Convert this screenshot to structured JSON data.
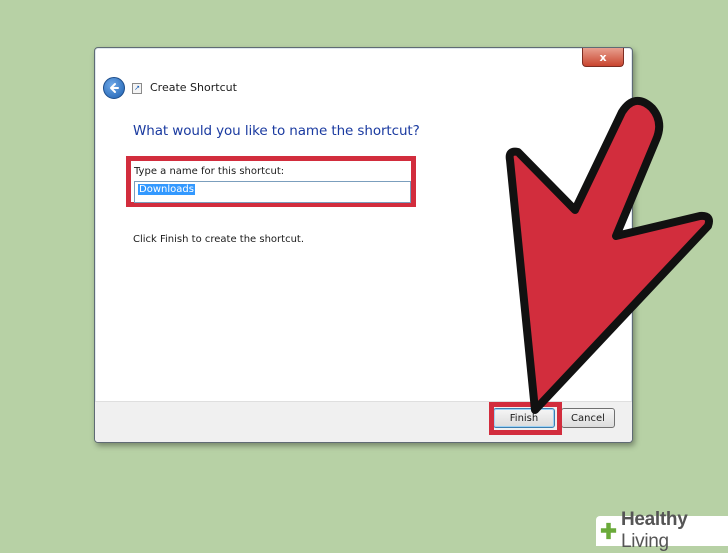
{
  "dialog": {
    "close_label": "x",
    "title": "Create Shortcut",
    "heading": "What would you like to name the shortcut?",
    "field_label": "Type a name for this shortcut:",
    "name_value": "Downloads",
    "instruction": "Click Finish to create the shortcut.",
    "buttons": {
      "finish": "Finish",
      "cancel": "Cancel"
    }
  },
  "watermark": {
    "brand_bold": "Healthy",
    "brand_light": " Living"
  },
  "colors": {
    "background": "#b7d1a5",
    "highlight": "#d22d3d",
    "heading": "#1a3aa0",
    "selection": "#3399ff"
  },
  "icons": [
    "close-icon",
    "back-arrow-icon",
    "shortcut-wizard-icon",
    "red-pointer-arrow",
    "healthy-living-logo-icon"
  ]
}
